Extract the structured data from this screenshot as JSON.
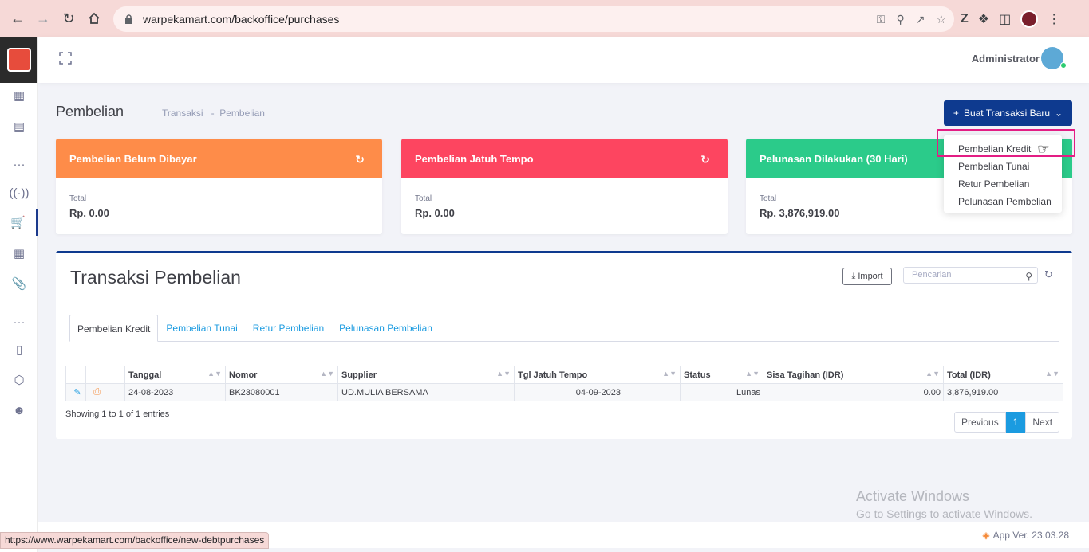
{
  "browser": {
    "url": "warpekamart.com/backoffice/purchases",
    "status_url": "https://www.warpekamart.com/backoffice/new-debtpurchases"
  },
  "header": {
    "user_name": "Administrator"
  },
  "subheader": {
    "title": "Pembelian",
    "breadcrumb": "Transaksi   -  Pembelian",
    "new_button": "Buat Transaksi Baru"
  },
  "dropdown": {
    "items": [
      "Pembelian Kredit",
      "Pembelian Tunai",
      "Retur Pembelian",
      "Pelunasan Pembelian"
    ]
  },
  "cards": [
    {
      "title": "Pembelian Belum Dibayar",
      "label": "Total",
      "value": "Rp. 0.00",
      "color": "#fe8c49"
    },
    {
      "title": "Pembelian Jatuh Tempo",
      "label": "Total",
      "value": "Rp. 0.00",
      "color": "#fd4560"
    },
    {
      "title": "Pelunasan Dilakukan (30 Hari)",
      "label": "Total",
      "value": "Rp. 3,876,919.00",
      "color": "#2bcb8a"
    }
  ],
  "panel": {
    "title": "Transaksi Pembelian",
    "import_label": "Import",
    "search_placeholder": "Pencarian",
    "tabs": [
      "Pembelian Kredit",
      "Pembelian Tunai",
      "Retur Pembelian",
      "Pelunasan Pembelian"
    ],
    "columns": [
      "Tanggal",
      "Nomor",
      "Supplier",
      "Tgl Jatuh Tempo",
      "Status",
      "Sisa Tagihan (IDR)",
      "Total (IDR)"
    ],
    "rows": [
      {
        "tanggal": "24-08-2023",
        "nomor": "BK23080001",
        "supplier": "UD.MULIA BERSAMA",
        "jatuh_tempo": "04-09-2023",
        "status": "Lunas",
        "sisa": "0.00",
        "total": "3,876,919.00"
      }
    ],
    "info": "Showing 1 to 1 of 1 entries",
    "pagination": {
      "prev": "Previous",
      "current": "1",
      "next": "Next"
    }
  },
  "watermark": {
    "line1": "Activate Windows",
    "line2": "Go to Settings to activate Windows."
  },
  "footer": {
    "version": "App Ver. 23.03.28"
  }
}
